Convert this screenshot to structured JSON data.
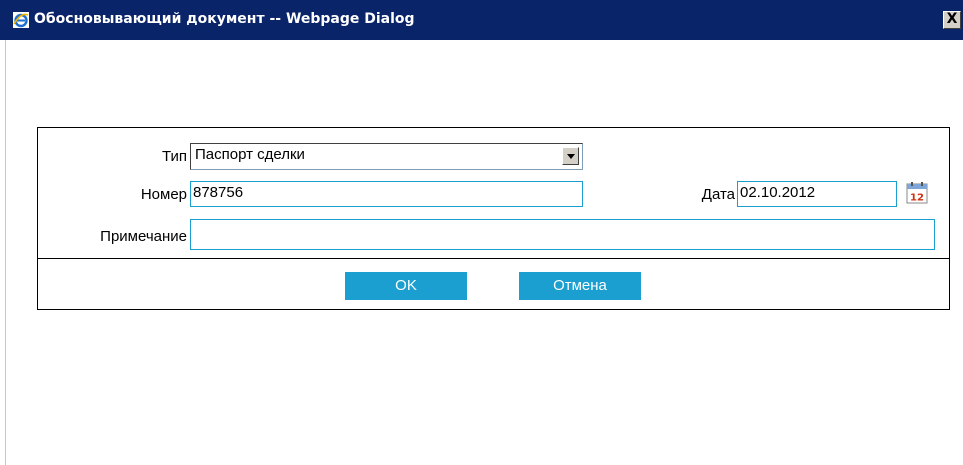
{
  "window": {
    "title": "Обосновывающий документ -- Webpage Dialog",
    "close_glyph": "X"
  },
  "form": {
    "type_label": "Тип",
    "type_value": "Паспорт сделки",
    "number_label": "Номер",
    "number_value": "878756",
    "date_label": "Дата",
    "date_value": "02.10.2012",
    "note_label": "Примечание",
    "note_value": ""
  },
  "buttons": {
    "ok": "OK",
    "cancel": "Отмена"
  },
  "icons": {
    "title_icon": "ie-icon",
    "calendar_icon": "calendar-icon",
    "calendar_day": "12"
  },
  "colors": {
    "titlebar": "#0a246a",
    "accent": "#1a9fd0"
  }
}
